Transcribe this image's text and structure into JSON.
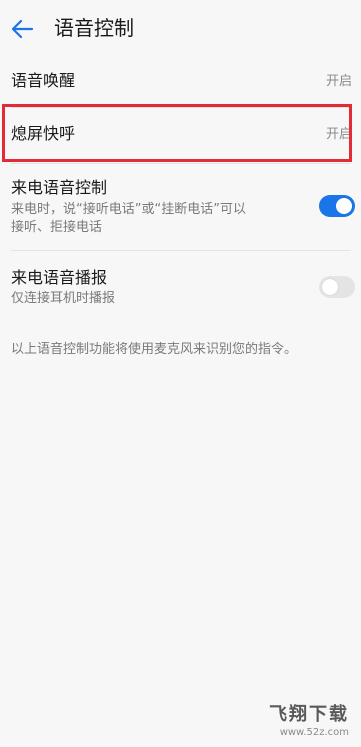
{
  "header": {
    "title": "语音控制",
    "back_icon": "arrow-left-icon",
    "accent": "#1a75e8"
  },
  "settings": {
    "voice_wakeup": {
      "title": "语音唤醒",
      "value": "开启"
    },
    "screen_off_quick_call": {
      "title": "熄屏快呼",
      "value": "开启"
    },
    "incoming_call_voice_control": {
      "title": "来电语音控制",
      "subtitle": "来电时，说“接听电话”或“挂断电话”可以接听、拒接电话",
      "enabled": true
    },
    "incoming_call_voice_announce": {
      "title": "来电语音播报",
      "subtitle": "仅连接耳机时播报",
      "enabled": false
    }
  },
  "footnote": "以上语音控制功能将使用麦克风来识别您的指令。",
  "highlight_color": "#e32b35",
  "watermark": {
    "main": "飞翔下载",
    "url": "www.52z.com"
  }
}
